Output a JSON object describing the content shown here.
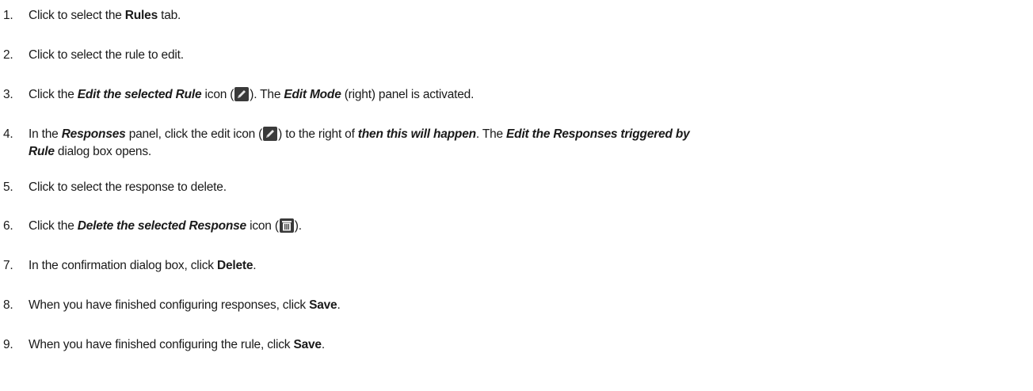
{
  "steps": [
    {
      "number": "1.",
      "parts": [
        {
          "t": "Click to select the "
        },
        {
          "t": "Rules",
          "s": "bold"
        },
        {
          "t": " tab."
        }
      ]
    },
    {
      "number": "2.",
      "parts": [
        {
          "t": "Click to select the rule to edit."
        }
      ]
    },
    {
      "number": "3.",
      "parts": [
        {
          "t": "Click the "
        },
        {
          "t": "Edit the selected Rule",
          "s": "em"
        },
        {
          "t": " icon ("
        },
        {
          "icon": "pencil-icon"
        },
        {
          "t": "). The "
        },
        {
          "t": "Edit Mode",
          "s": "em"
        },
        {
          "t": " (right) panel is activated."
        }
      ]
    },
    {
      "number": "4.",
      "parts": [
        {
          "t": "In the "
        },
        {
          "t": "Responses",
          "s": "em"
        },
        {
          "t": " panel, click the edit icon ("
        },
        {
          "icon": "pencil-icon"
        },
        {
          "t": ") to the right of "
        },
        {
          "t": "then this will happen",
          "s": "em"
        },
        {
          "t": ". The "
        },
        {
          "t": "Edit the Responses triggered by",
          "s": "em"
        },
        {
          "br": true
        },
        {
          "t": "Rule",
          "s": "em"
        },
        {
          "t": " dialog box opens."
        }
      ]
    },
    {
      "number": "5.",
      "parts": [
        {
          "t": "Click to select the response to delete."
        }
      ]
    },
    {
      "number": "6.",
      "parts": [
        {
          "t": "Click the "
        },
        {
          "t": "Delete the selected Response",
          "s": "em"
        },
        {
          "t": " icon ("
        },
        {
          "icon": "trash-icon"
        },
        {
          "t": ")."
        }
      ]
    },
    {
      "number": "7.",
      "parts": [
        {
          "t": "In the confirmation dialog box, click "
        },
        {
          "t": "Delete",
          "s": "bold"
        },
        {
          "t": "."
        }
      ]
    },
    {
      "number": "8.",
      "parts": [
        {
          "t": "When you have finished configuring responses, click "
        },
        {
          "t": "Save",
          "s": "bold"
        },
        {
          "t": "."
        }
      ]
    },
    {
      "number": "9.",
      "parts": [
        {
          "t": "When you have finished configuring the rule, click "
        },
        {
          "t": "Save",
          "s": "bold"
        },
        {
          "t": "."
        }
      ]
    }
  ]
}
